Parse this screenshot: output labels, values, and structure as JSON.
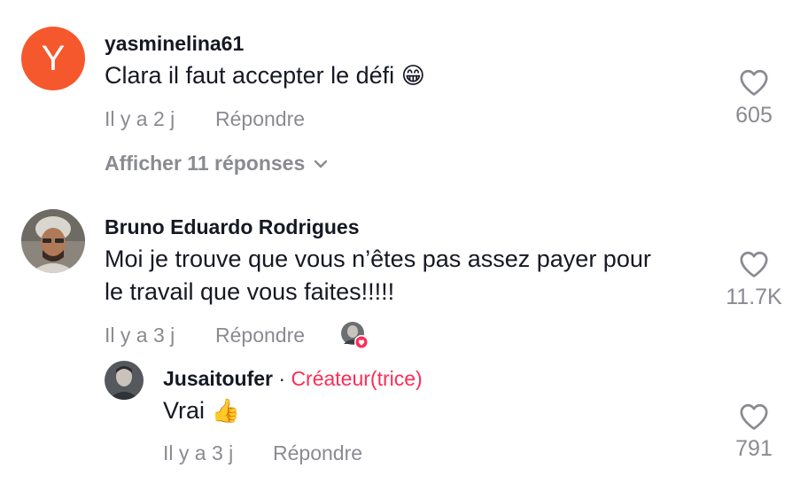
{
  "comments": [
    {
      "avatar_letter": "Y",
      "username": "yasminelina61",
      "text": "Clara il faut accepter le défi",
      "emoji": "😁",
      "time": "Il y a 2 j",
      "reply_label": "Répondre",
      "likes": "605",
      "more_replies": "Afficher 11 réponses"
    },
    {
      "username": "Bruno Eduardo Rodrigues",
      "text_line1": "Moi je trouve que vous n’êtes pas assez payer pour",
      "text_line2": "le travail que vous faites!!!!!",
      "time": "Il y a 3 j",
      "reply_label": "Répondre",
      "likes": "11.7K"
    }
  ],
  "reply": {
    "username": "Jusaitoufer",
    "separator": "·",
    "badge": "Créateur(trice)",
    "text": "Vrai",
    "emoji": "👍",
    "time": "Il y a 3 j",
    "reply_label": "Répondre",
    "likes": "791"
  },
  "colors": {
    "accent": "#fe2c55",
    "avatar_y": "#f5582d",
    "secondary": "#8a8b91"
  }
}
